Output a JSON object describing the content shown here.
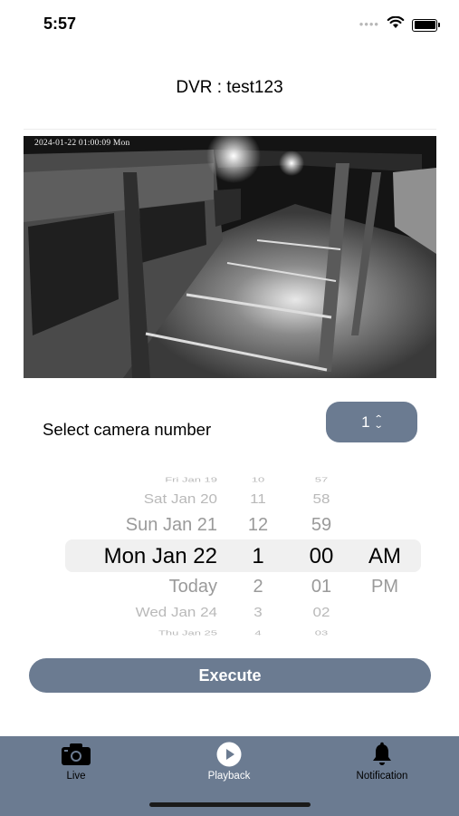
{
  "status_bar": {
    "time": "5:57"
  },
  "header": {
    "title": "DVR : test123"
  },
  "camera": {
    "timestamp": "2024-01-22 01:00:09 Mon"
  },
  "selector": {
    "label": "Select camera number",
    "value": "1"
  },
  "picker": {
    "rows": [
      {
        "date": "Fri Jan 19",
        "hour": "10",
        "minute": "57",
        "ampm": ""
      },
      {
        "date": "Sat Jan 20",
        "hour": "11",
        "minute": "58",
        "ampm": ""
      },
      {
        "date": "Sun Jan 21",
        "hour": "12",
        "minute": "59",
        "ampm": ""
      },
      {
        "date": "Mon Jan 22",
        "hour": "1",
        "minute": "00",
        "ampm": "AM"
      },
      {
        "date": "Today",
        "hour": "2",
        "minute": "01",
        "ampm": "PM"
      },
      {
        "date": "Wed Jan 24",
        "hour": "3",
        "minute": "02",
        "ampm": ""
      },
      {
        "date": "Thu Jan 25",
        "hour": "4",
        "minute": "03",
        "ampm": ""
      }
    ]
  },
  "execute": {
    "label": "Execute"
  },
  "tabs": [
    {
      "label": "Live",
      "icon": "camera-icon"
    },
    {
      "label": "Playback",
      "icon": "play-icon"
    },
    {
      "label": "Notification",
      "icon": "bell-icon"
    }
  ]
}
